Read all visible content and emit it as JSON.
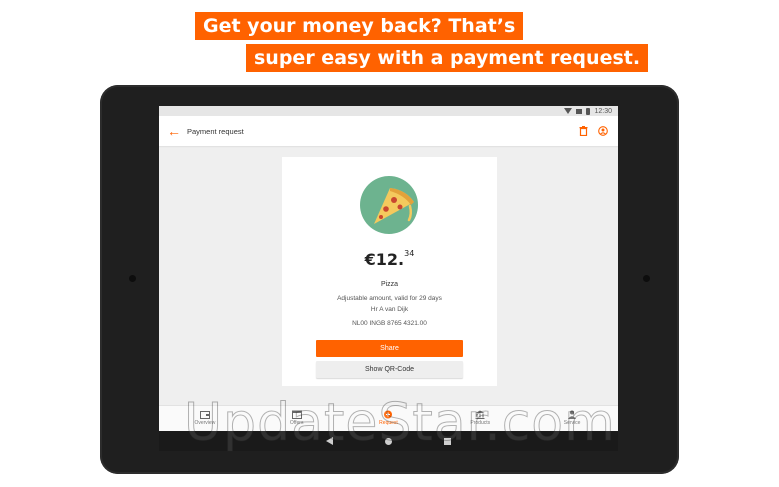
{
  "banner": {
    "line1": "Get your money back? That’s",
    "line2": "super easy with a payment request."
  },
  "status_bar": {
    "time": "12:30"
  },
  "app_bar": {
    "title": "Payment request"
  },
  "request": {
    "amount_main": "€12.",
    "amount_cents": "34",
    "title": "Pizza",
    "details": [
      "Adjustable amount, valid for 29 days",
      "Hr A van Dijk",
      "NL00 INGB 8765 4321.00"
    ]
  },
  "buttons": {
    "share": "Share",
    "qr": "Show QR-Code"
  },
  "bottom_nav": [
    {
      "label": "Overview",
      "icon": "wallet-icon"
    },
    {
      "label": "Offers",
      "icon": "calendar-icon"
    },
    {
      "label": "Request",
      "icon": "request-icon",
      "active": true
    },
    {
      "label": "Products",
      "icon": "bank-icon"
    },
    {
      "label": "Service",
      "icon": "person-icon"
    }
  ],
  "watermark": "UpdateStar.com",
  "colors": {
    "accent": "#ff6200",
    "pizza_bg": "#6db38f"
  }
}
